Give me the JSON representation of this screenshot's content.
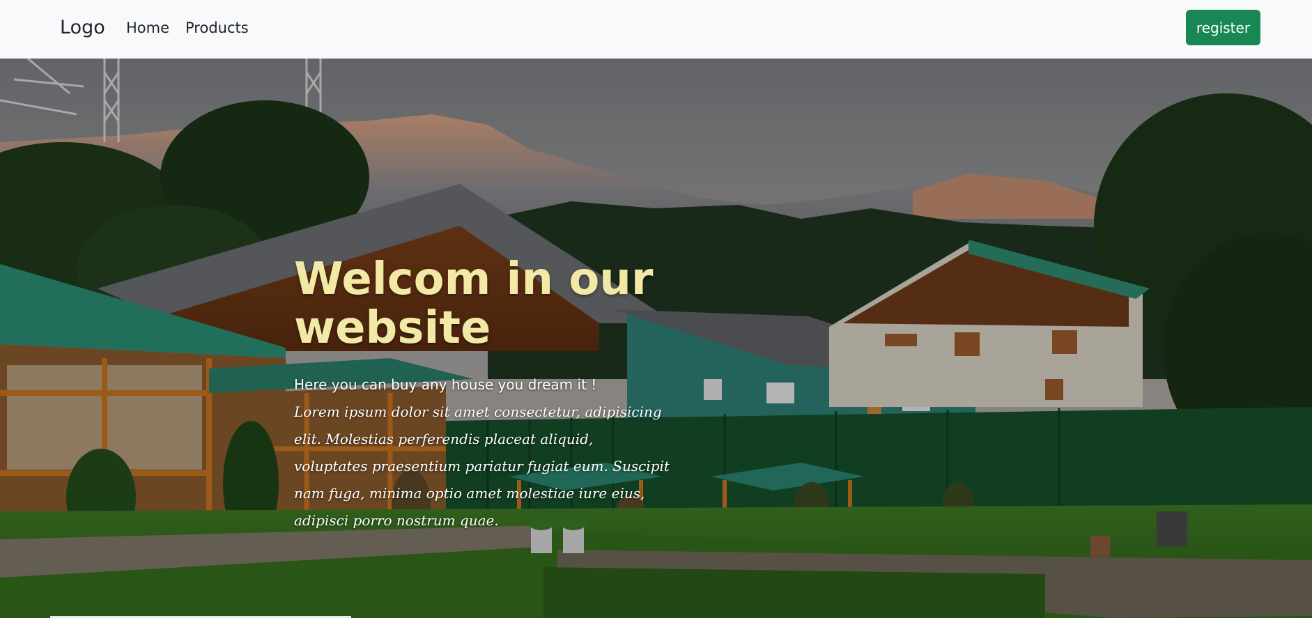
{
  "navbar": {
    "brand": "Logo",
    "links": [
      {
        "label": "Home"
      },
      {
        "label": "Products"
      }
    ],
    "register_label": "register",
    "register_color": "#198754"
  },
  "hero": {
    "title": "Welcom in our website",
    "tagline": "Here you can buy any house you dream it !",
    "body": "Lorem ipsum dolor sit amet consectetur, adipisicing elit. Molestias perferendis placeat aliquid, voluptates praesentium pariatur fugiat eum. Suscipit nam fuga, minima optio amet molestiae iure eius, adipisci porro nostrum quae.",
    "title_color": "#f3e9a6"
  }
}
